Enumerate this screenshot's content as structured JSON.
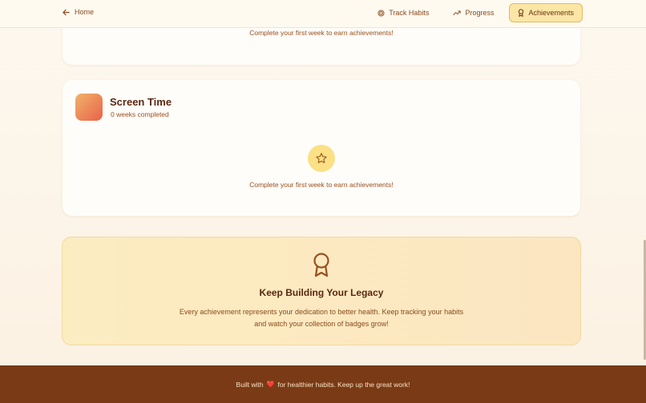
{
  "nav": {
    "home_label": "Home",
    "track_label": "Track Habits",
    "progress_label": "Progress",
    "achievements_label": "Achievements"
  },
  "cards": {
    "first": {
      "empty_message": "Complete your first week to earn achievements!"
    },
    "screen_time": {
      "title": "Screen Time",
      "subtitle": "0 weeks completed",
      "empty_message": "Complete your first week to earn achievements!"
    }
  },
  "legacy": {
    "title": "Keep Building Your Legacy",
    "text": "Every achievement represents your dedication to better health. Keep tracking your habits and watch your collection of badges grow!"
  },
  "footer": {
    "prefix": "Built with",
    "heart": "❤️",
    "suffix": "for healthier habits. Keep up the great work!"
  },
  "colors": {
    "accent": "#fbe6a6",
    "brand_brown": "#7a3a16",
    "text_brown": "#8a4a1c"
  }
}
